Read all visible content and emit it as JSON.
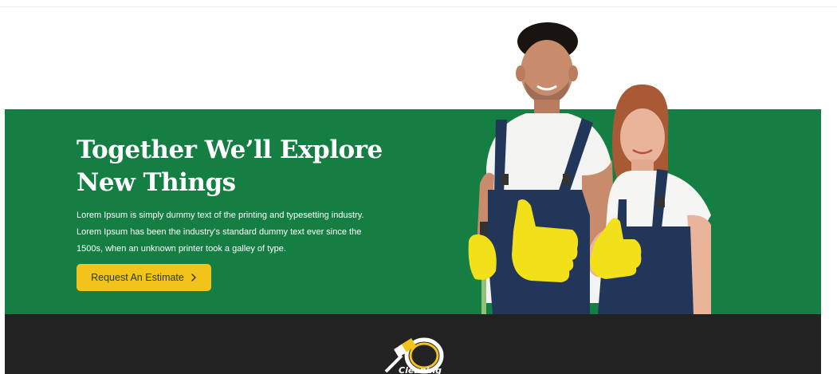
{
  "hero": {
    "title_line1": "Together We’ll Explore",
    "title_line2": "New Things",
    "description": "Lorem Ipsum is simply dummy text of the printing and typesetting  industry. Lorem Ipsum has been the industry's standard dummy text ever since the 1500s, when an unknown printer took a galley of type.",
    "cta_label": "Request An Estimate",
    "cta_icon": "chevron-right-icon"
  },
  "footer": {
    "logo_text": "Cleaning"
  },
  "colors": {
    "hero_bg": "#157f43",
    "accent": "#f2c31b",
    "footer_bg": "#222222",
    "glove": "#f2e01b",
    "overall": "#1d3557"
  },
  "image": {
    "subject": "two-cleaners-thumbs-up"
  }
}
